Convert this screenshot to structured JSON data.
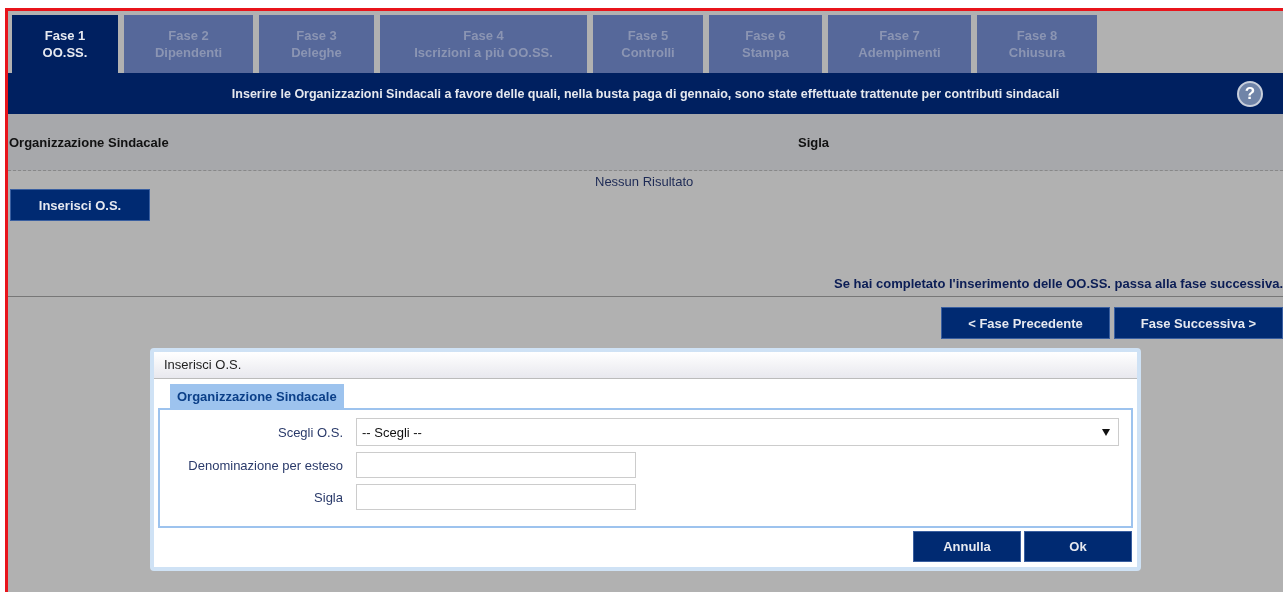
{
  "tabs": [
    {
      "number": "Fase 1",
      "label": "OO.SS.",
      "selected": true
    },
    {
      "number": "Fase 2",
      "label": "Dipendenti",
      "selected": false
    },
    {
      "number": "Fase 3",
      "label": "Deleghe",
      "selected": false
    },
    {
      "number": "Fase 4",
      "label": "Iscrizioni a più OO.SS.",
      "selected": false
    },
    {
      "number": "Fase 5",
      "label": "Controlli",
      "selected": false
    },
    {
      "number": "Fase 6",
      "label": "Stampa",
      "selected": false
    },
    {
      "number": "Fase 7",
      "label": "Adempimenti",
      "selected": false
    },
    {
      "number": "Fase 8",
      "label": "Chiusura",
      "selected": false
    }
  ],
  "banner": {
    "text": "Inserire le Organizzazioni Sindacali a favore delle quali, nella busta paga di gennaio, sono state effettuate trattenute per contributi sindacali",
    "help": "?"
  },
  "table": {
    "columns": [
      "Organizzazione Sindacale",
      "Sigla"
    ],
    "empty_message": "Nessun Risultato"
  },
  "insert_button": "Inserisci O.S.",
  "hint": "Se hai completato l'inserimento delle OO.SS. passa alla fase successiva.",
  "nav_buttons": [
    "< Fase Precedente",
    "Fase Successiva >"
  ],
  "dialog": {
    "title": "Inserisci O.S.",
    "tab": "Organizzazione Sindacale",
    "fields": [
      {
        "kind": "select",
        "label": "Scegli O.S.",
        "value": "-- Scegli --"
      },
      {
        "kind": "text",
        "label": "Denominazione per esteso"
      },
      {
        "kind": "text",
        "label": "Sigla"
      }
    ],
    "buttons": [
      "Annulla",
      "Ok"
    ]
  }
}
